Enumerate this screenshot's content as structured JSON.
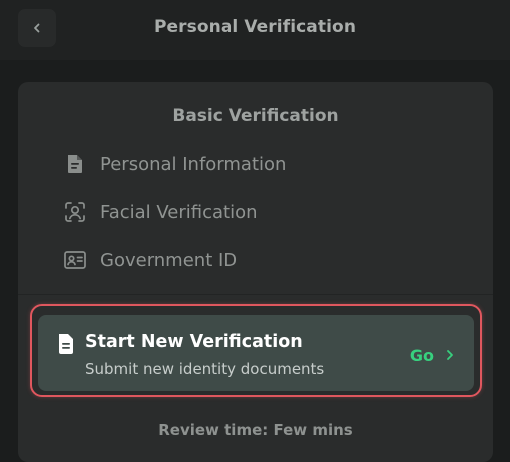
{
  "header": {
    "title": "Personal Verification",
    "back_icon": "chevron-left-icon"
  },
  "card": {
    "section_title": "Basic Verification",
    "steps": [
      {
        "label": "Personal Information",
        "icon": "document-icon"
      },
      {
        "label": "Facial Verification",
        "icon": "face-scan-icon"
      },
      {
        "label": "Government ID",
        "icon": "id-card-icon"
      }
    ],
    "cta": {
      "title": "Start New Verification",
      "subtitle": "Submit new identity documents",
      "action_label": "Go",
      "icon": "document-icon",
      "action_icon": "chevron-right-icon"
    },
    "review_text": "Review time: Few mins"
  },
  "colors": {
    "background": "#1b1d1d",
    "card": "#2a2c2c",
    "cta_background": "#3f4b48",
    "accent_green": "#37d07e",
    "highlight_red": "#e0575e"
  }
}
